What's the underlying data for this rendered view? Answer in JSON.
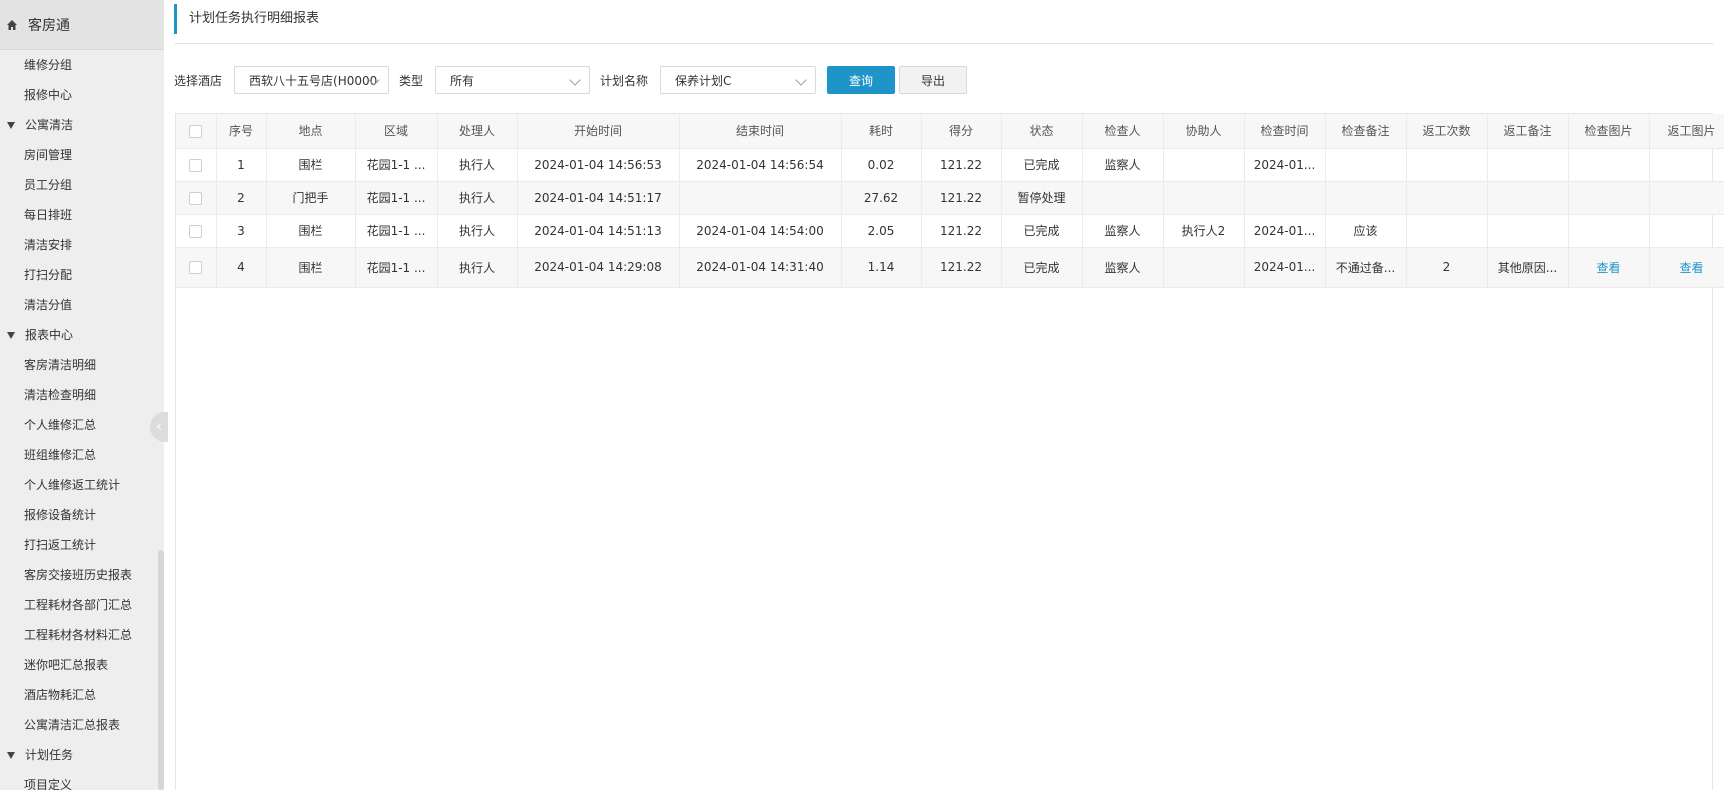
{
  "sidebar": {
    "title": "客房通",
    "items": [
      {
        "type": "item",
        "label": "维修分组"
      },
      {
        "type": "item",
        "label": "报修中心"
      },
      {
        "type": "group",
        "label": "公寓清洁"
      },
      {
        "type": "item",
        "label": "房间管理"
      },
      {
        "type": "item",
        "label": "员工分组"
      },
      {
        "type": "item",
        "label": "每日排班"
      },
      {
        "type": "item",
        "label": "清洁安排"
      },
      {
        "type": "item",
        "label": "打扫分配"
      },
      {
        "type": "item",
        "label": "清洁分值"
      },
      {
        "type": "group",
        "label": "报表中心"
      },
      {
        "type": "item",
        "label": "客房清洁明细"
      },
      {
        "type": "item",
        "label": "清洁检查明细"
      },
      {
        "type": "item",
        "label": "个人维修汇总"
      },
      {
        "type": "item",
        "label": "班组维修汇总"
      },
      {
        "type": "item",
        "label": "个人维修返工统计"
      },
      {
        "type": "item",
        "label": "报修设备统计"
      },
      {
        "type": "item",
        "label": "打扫返工统计"
      },
      {
        "type": "item",
        "label": "客房交接班历史报表"
      },
      {
        "type": "item",
        "label": "工程耗材各部门汇总"
      },
      {
        "type": "item",
        "label": "工程耗材各材料汇总"
      },
      {
        "type": "item",
        "label": "迷你吧汇总报表"
      },
      {
        "type": "item",
        "label": "酒店物耗汇总"
      },
      {
        "type": "item",
        "label": "公寓清洁汇总报表"
      },
      {
        "type": "group",
        "label": "计划任务"
      },
      {
        "type": "item",
        "label": "项目定义"
      }
    ]
  },
  "page": {
    "title": "计划任务执行明细报表"
  },
  "filters": {
    "hotel_label": "选择酒店",
    "hotel_value": "西软八十五号店(H0000",
    "type_label": "类型",
    "type_value": "所有",
    "plan_label": "计划名称",
    "plan_value": "保养计划C",
    "query_label": "查询",
    "export_label": "导出"
  },
  "table": {
    "columns": [
      "序号",
      "地点",
      "区域",
      "处理人",
      "开始时间",
      "结束时间",
      "耗时",
      "得分",
      "状态",
      "检查人",
      "协助人",
      "检查时间",
      "检查备注",
      "返工次数",
      "返工备注",
      "检查图片",
      "返工图片"
    ],
    "rows": [
      [
        "1",
        "围栏",
        "花园1-1 ...",
        "执行人",
        "2024-01-04 14:56:53",
        "2024-01-04 14:56:54",
        "0.02",
        "121.22",
        "已完成",
        "监察人",
        "",
        "2024-01...",
        "",
        "",
        "",
        "",
        ""
      ],
      [
        "2",
        "门把手",
        "花园1-1 ...",
        "执行人",
        "2024-01-04 14:51:17",
        "",
        "27.62",
        "121.22",
        "暂停处理",
        "",
        "",
        "",
        "",
        "",
        "",
        "",
        ""
      ],
      [
        "3",
        "围栏",
        "花园1-1 ...",
        "执行人",
        "2024-01-04 14:51:13",
        "2024-01-04 14:54:00",
        "2.05",
        "121.22",
        "已完成",
        "监察人",
        "执行人2",
        "2024-01...",
        "应该",
        "",
        "",
        "",
        ""
      ],
      [
        "4",
        "围栏",
        "花园1-1 ...",
        "执行人",
        "2024-01-04 14:29:08",
        "2024-01-04 14:31:40",
        "1.14",
        "121.22",
        "已完成",
        "监察人",
        "",
        "2024-01...",
        "不通过备...",
        "2",
        "其他原因...",
        "查看",
        "查看"
      ]
    ]
  },
  "colors": {
    "accent": "#1e94c9",
    "sidebar_bg": "#eeeeee"
  }
}
